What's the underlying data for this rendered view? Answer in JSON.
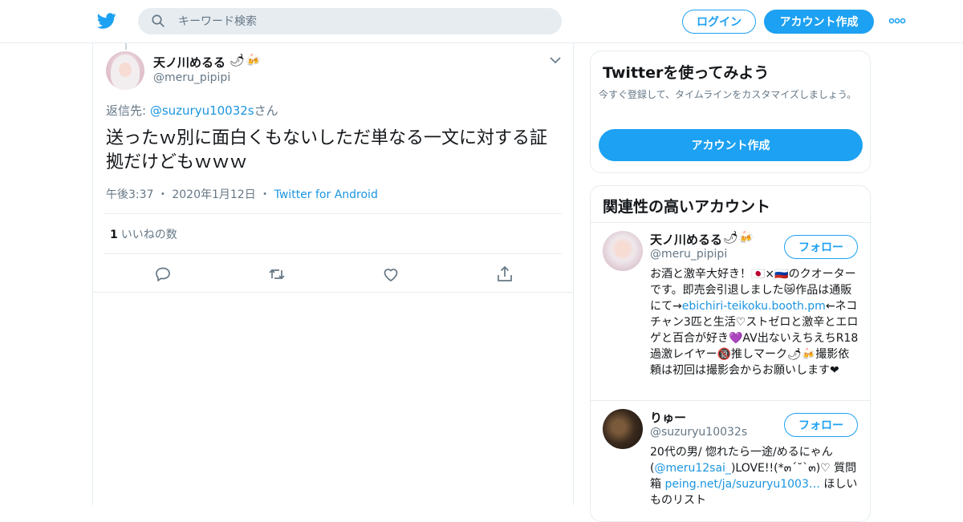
{
  "header": {
    "search_placeholder": "キーワード検索",
    "login_label": "ログイン",
    "signup_label": "アカウント作成"
  },
  "tweet": {
    "author_name": "天ノ川めるる",
    "author_emoji": "🌶🍻",
    "author_handle": "@meru_pipipi",
    "reply_prefix": "返信先: ",
    "reply_handle": "@suzuryu10032s",
    "reply_suffix": "さん",
    "text": "送ったｗ別に面白くもないしただ単なる一文に対する証拠だけどもｗｗｗ",
    "time": "午後3:37",
    "date": "2020年1月12日",
    "source": "Twitter for Android",
    "like_count": "1",
    "like_label": "いいねの数"
  },
  "signup_card": {
    "title": "Twitterを使ってみよう",
    "description": "今すぐ登録して、タイムラインをカスタマイズしましょう。",
    "button_label": "アカウント作成"
  },
  "related": {
    "title": "関連性の高いアカウント",
    "accounts": [
      {
        "name": "天ノ川めるる",
        "emoji": "🌶🍻",
        "handle": "@meru_pipipi",
        "follow_label": "フォロー",
        "bio_1": "お酒と激辛大好き！🇯🇵×🇷🇺のクオーターです。即売会引退しました😿作品は通販にて→",
        "bio_link": "ebichiri-teikoku.booth.pm",
        "bio_2": "←ネコチャン3匹と生活♡ストゼロと激辛とエロゲと百合が好き💜AV出ないえちえちR18過激レイヤー🔞推しマーク🌶🍻撮影依頼は初回は撮影会からお願いします❤"
      },
      {
        "name": "りゅー",
        "emoji": "",
        "handle": "@suzuryu10032s",
        "follow_label": "フォロー",
        "bio_1": "20代の男/ 惚れたら一途/めるにゃん(",
        "bio_link": "@meru12sai_",
        "bio_2": ")LOVE!!(*๓´˘`๓)♡ 質問箱 ",
        "bio_link2": "peing.net/ja/suzuryu1003…",
        "bio_3": " ほしいものリスト"
      }
    ]
  },
  "colors": {
    "accent": "#1da1f2",
    "link": "#1b95e0",
    "muted": "#657786",
    "border": "#e6ecf0"
  }
}
